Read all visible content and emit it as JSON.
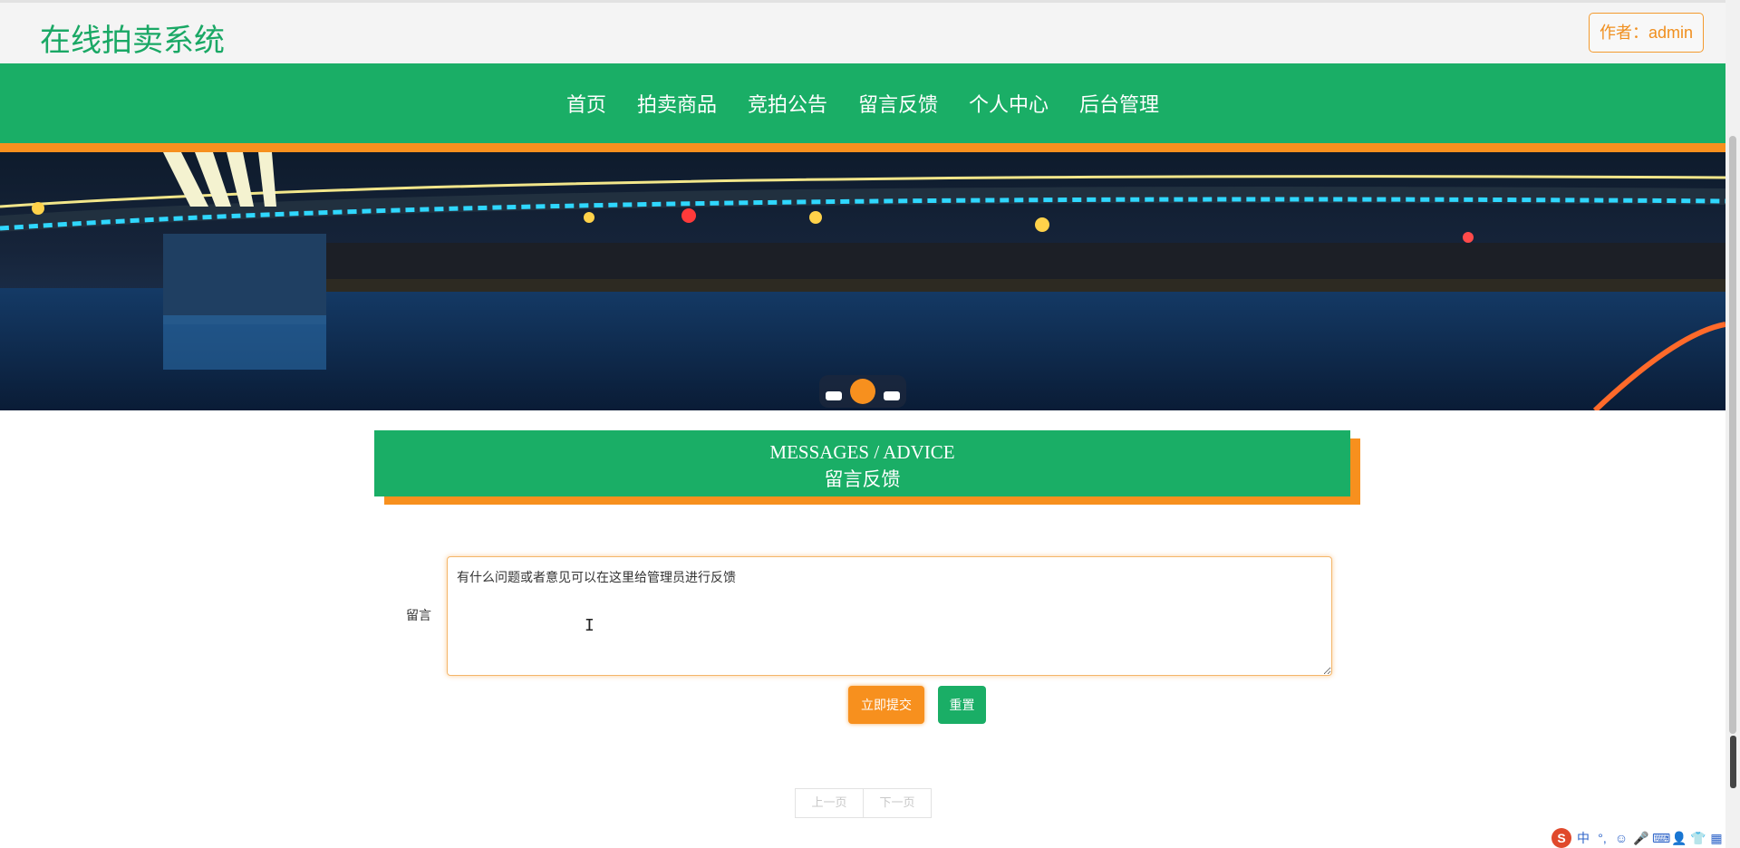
{
  "header": {
    "site_title": "在线拍卖系统",
    "author_badge": "作者：admin"
  },
  "nav": {
    "items": [
      "首页",
      "拍卖商品",
      "竞拍公告",
      "留言反馈",
      "个人中心",
      "后台管理"
    ]
  },
  "banner": {
    "slide_count": 3,
    "active_slide": 2
  },
  "section": {
    "title_en": "MESSAGES / ADVICE",
    "title_cn": "留言反馈"
  },
  "form": {
    "message_label": "留言",
    "message_value": "有什么问题或者意见可以在这里给管理员进行反馈",
    "submit_label": "立即提交",
    "reset_label": "重置"
  },
  "pagination": {
    "prev_label": "上一页",
    "next_label": "下一页"
  },
  "ime": {
    "logo": "S",
    "items": [
      "中",
      "°,",
      "☺",
      "🎤",
      "⌨",
      "👤",
      "👕",
      "▦"
    ]
  },
  "colors": {
    "brand_green": "#1aae66",
    "accent_orange": "#f7901e"
  }
}
